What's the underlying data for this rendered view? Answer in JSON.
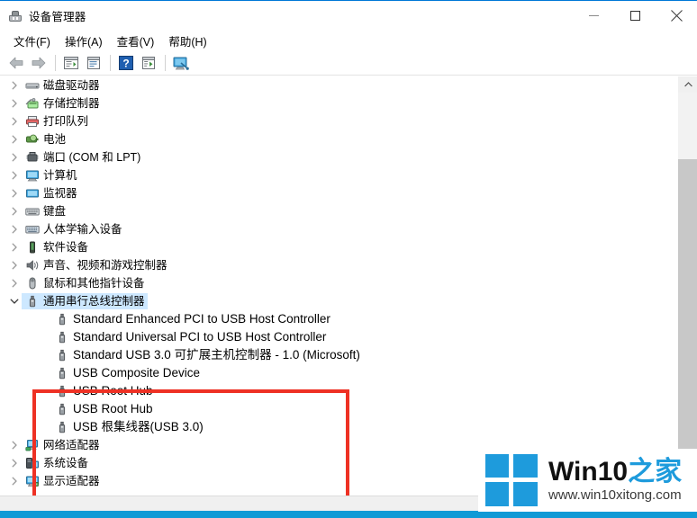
{
  "window": {
    "title": "设备管理器",
    "icon": "device-manager-icon",
    "controls": [
      {
        "name": "minimize-button",
        "glyph": "minimize-icon"
      },
      {
        "name": "maximize-button",
        "glyph": "maximize-icon"
      },
      {
        "name": "close-button",
        "glyph": "close-icon"
      }
    ]
  },
  "menubar": {
    "items": [
      {
        "label": "文件(F)",
        "name": "menu-file"
      },
      {
        "label": "操作(A)",
        "name": "menu-action"
      },
      {
        "label": "查看(V)",
        "name": "menu-view"
      },
      {
        "label": "帮助(H)",
        "name": "menu-help"
      }
    ]
  },
  "toolbar": {
    "buttons": [
      {
        "name": "back-button",
        "icon": "back-arrow-icon"
      },
      {
        "name": "forward-button",
        "icon": "forward-arrow-icon"
      },
      {
        "name": "separator-1",
        "icon": "separator"
      },
      {
        "name": "properties-button",
        "icon": "properties-icon"
      },
      {
        "name": "show-hidden-button",
        "icon": "window-icon"
      },
      {
        "name": "separator-2",
        "icon": "separator"
      },
      {
        "name": "help-button",
        "icon": "question-mark-icon"
      },
      {
        "name": "update-driver-button",
        "icon": "play-window-icon"
      },
      {
        "name": "separator-3",
        "icon": "separator"
      },
      {
        "name": "scan-hardware-button",
        "icon": "computer-scan-icon"
      }
    ]
  },
  "tree": {
    "rows": [
      {
        "label": "磁盘驱动器",
        "icon": "disk-drive-icon",
        "expandable": true,
        "expanded": false,
        "indent": 0,
        "selected": false,
        "latin": false
      },
      {
        "label": "存储控制器",
        "icon": "storage-controller-icon",
        "expandable": true,
        "expanded": false,
        "indent": 0,
        "selected": false,
        "latin": false
      },
      {
        "label": "打印队列",
        "icon": "printer-icon",
        "expandable": true,
        "expanded": false,
        "indent": 0,
        "selected": false,
        "latin": false
      },
      {
        "label": "电池",
        "icon": "battery-icon",
        "expandable": true,
        "expanded": false,
        "indent": 0,
        "selected": false,
        "latin": false
      },
      {
        "label": "端口 (COM 和 LPT)",
        "icon": "port-icon",
        "expandable": true,
        "expanded": false,
        "indent": 0,
        "selected": false,
        "latin": false
      },
      {
        "label": "计算机",
        "icon": "computer-icon",
        "expandable": true,
        "expanded": false,
        "indent": 0,
        "selected": false,
        "latin": false
      },
      {
        "label": "监视器",
        "icon": "monitor-icon",
        "expandable": true,
        "expanded": false,
        "indent": 0,
        "selected": false,
        "latin": false
      },
      {
        "label": "键盘",
        "icon": "keyboard-icon",
        "expandable": true,
        "expanded": false,
        "indent": 0,
        "selected": false,
        "latin": false
      },
      {
        "label": "人体学输入设备",
        "icon": "hid-icon",
        "expandable": true,
        "expanded": false,
        "indent": 0,
        "selected": false,
        "latin": false
      },
      {
        "label": "软件设备",
        "icon": "software-device-icon",
        "expandable": true,
        "expanded": false,
        "indent": 0,
        "selected": false,
        "latin": false
      },
      {
        "label": "声音、视频和游戏控制器",
        "icon": "sound-icon",
        "expandable": true,
        "expanded": false,
        "indent": 0,
        "selected": false,
        "latin": false
      },
      {
        "label": "鼠标和其他指针设备",
        "icon": "mouse-icon",
        "expandable": true,
        "expanded": false,
        "indent": 0,
        "selected": false,
        "latin": false
      },
      {
        "label": "通用串行总线控制器",
        "icon": "usb-icon",
        "expandable": true,
        "expanded": true,
        "indent": 0,
        "selected": true,
        "latin": false
      },
      {
        "label": "Standard Enhanced PCI to USB Host Controller",
        "icon": "usb-device-icon",
        "expandable": false,
        "expanded": false,
        "indent": 1,
        "selected": false,
        "latin": true
      },
      {
        "label": "Standard Universal PCI to USB Host Controller",
        "icon": "usb-device-icon",
        "expandable": false,
        "expanded": false,
        "indent": 1,
        "selected": false,
        "latin": true
      },
      {
        "label": "Standard USB 3.0 可扩展主机控制器 - 1.0 (Microsoft)",
        "icon": "usb-device-icon",
        "expandable": false,
        "expanded": false,
        "indent": 1,
        "selected": false,
        "latin": true
      },
      {
        "label": "USB Composite Device",
        "icon": "usb-device-icon",
        "expandable": false,
        "expanded": false,
        "indent": 1,
        "selected": false,
        "latin": true
      },
      {
        "label": "USB Root Hub",
        "icon": "usb-device-icon",
        "expandable": false,
        "expanded": false,
        "indent": 1,
        "selected": false,
        "latin": true
      },
      {
        "label": "USB Root Hub",
        "icon": "usb-device-icon",
        "expandable": false,
        "expanded": false,
        "indent": 1,
        "selected": false,
        "latin": true
      },
      {
        "label": "USB 根集线器(USB 3.0)",
        "icon": "usb-device-icon",
        "expandable": false,
        "expanded": false,
        "indent": 1,
        "selected": false,
        "latin": true
      },
      {
        "label": "网络适配器",
        "icon": "network-adapter-icon",
        "expandable": true,
        "expanded": false,
        "indent": 0,
        "selected": false,
        "latin": false
      },
      {
        "label": "系统设备",
        "icon": "system-device-icon",
        "expandable": true,
        "expanded": false,
        "indent": 0,
        "selected": false,
        "latin": false
      },
      {
        "label": "显示适配器",
        "icon": "display-adapter-icon",
        "expandable": true,
        "expanded": false,
        "indent": 0,
        "selected": false,
        "latin": false
      }
    ]
  },
  "annotation": {
    "red_box_color": "#ee3124",
    "highlighted_rows": [
      13,
      14,
      15,
      16,
      17,
      18,
      19
    ]
  },
  "scrollbar": {
    "up_arrow": "chevron-up-icon",
    "thumb_position_percent": 0
  },
  "watermark": {
    "brand": "Win10",
    "brand_suffix": "之家",
    "url": "www.win10xitong.com",
    "logo_color": "#1e9bdc"
  },
  "colors": {
    "selection": "#cde8ff",
    "accent": "#0078d7",
    "bottom_strip": "#0f9ad6"
  }
}
